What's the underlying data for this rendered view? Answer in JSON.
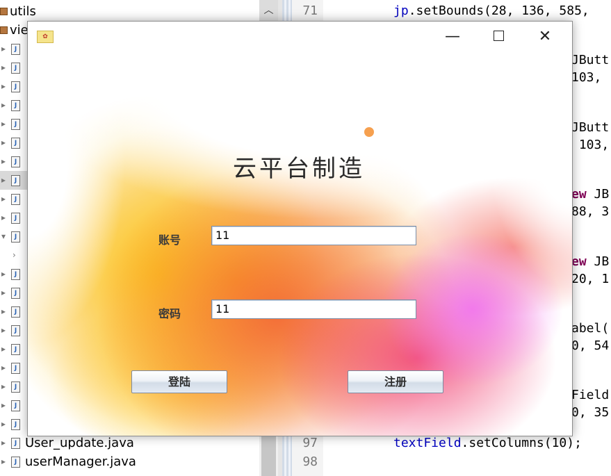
{
  "project_tree": {
    "package_utils": "utils",
    "package_view": "view",
    "file_user_update": "User_update.java",
    "file_user_manager": "userManager.java"
  },
  "editor": {
    "line_numbers": [
      "71",
      "97",
      "98"
    ],
    "lines": {
      "l71": {
        "obj": "jp",
        "rest": ".setBounds(28, 136, 585,"
      },
      "a1": "JButt",
      "a2": "103,",
      "b1": "JButt",
      "b2": " 103,",
      "c_kw": "ew",
      "c1": " JB",
      "c2": "88, 3",
      "d_kw": "ew",
      "d1": " JB",
      "d2": "20, 1",
      "e1": "abel(",
      "e2": "0, 54",
      "f1": "Field",
      "f2": "0, 35",
      "l97": {
        "obj": "textField",
        "rest": ".setColumns(10);"
      }
    }
  },
  "dialog": {
    "heading": "云平台制造",
    "account_label": "账号",
    "account_value": "11",
    "password_label": "密码",
    "password_value": "11",
    "login_button": "登陆",
    "register_button": "注册",
    "window_controls": {
      "minimize": "minimize-icon",
      "maximize": "maximize-icon",
      "close": "close-icon"
    }
  },
  "colors": {
    "keyword": "#7f0055",
    "field": "#0000c0",
    "splash_yellow": "#fcc81e",
    "splash_orange": "#f26032",
    "splash_pink": "#f03c6e",
    "splash_magenta": "#f06ef0"
  }
}
